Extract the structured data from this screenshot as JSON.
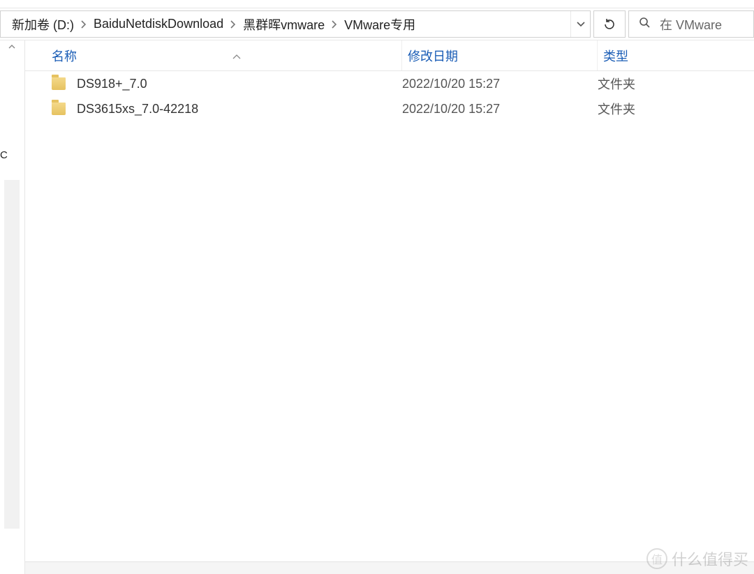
{
  "breadcrumb": {
    "items": [
      {
        "label": "新加卷 (D:)"
      },
      {
        "label": "BaiduNetdiskDownload"
      },
      {
        "label": "黑群晖vmware"
      },
      {
        "label": "VMware专用"
      }
    ]
  },
  "search": {
    "placeholder": "在 VMware"
  },
  "columns": {
    "name": "名称",
    "date": "修改日期",
    "type": "类型"
  },
  "rows": [
    {
      "icon": "folder",
      "name": "DS918+_7.0",
      "date": "2022/10/20 15:27",
      "type": "文件夹"
    },
    {
      "icon": "folder",
      "name": "DS3615xs_7.0-42218",
      "date": "2022/10/20 15:27",
      "type": "文件夹"
    }
  ],
  "watermark": {
    "badge": "值",
    "text": "什么值得买"
  }
}
